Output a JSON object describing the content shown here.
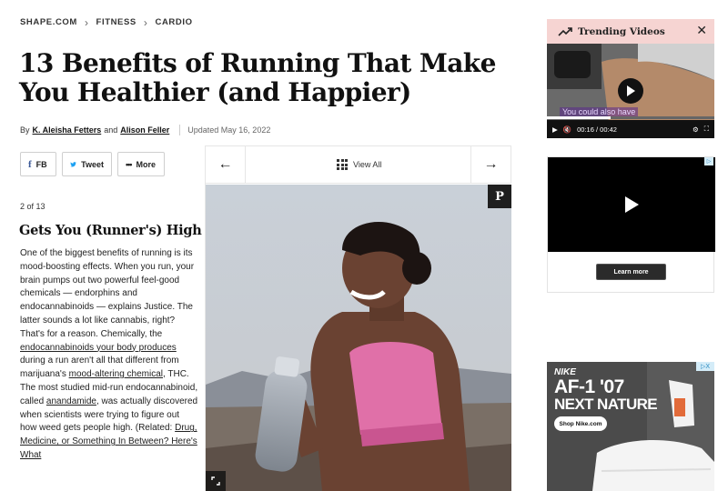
{
  "breadcrumb": {
    "items": [
      "SHAPE.COM",
      "FITNESS",
      "CARDIO"
    ]
  },
  "article": {
    "title": "13 Benefits of Running That Make You Healthier (and Happier)",
    "by_prefix": "By",
    "author1": "K. Aleisha Fetters",
    "and": "and",
    "author2": "Alison Feller",
    "updated": "Updated May 16, 2022"
  },
  "share": {
    "fb_label": "FB",
    "tweet_label": "Tweet",
    "more_label": "More"
  },
  "gallery": {
    "view_all": "View All",
    "counter": "2 of 13",
    "slide_title": "Gets You (Runner's) High",
    "pin_glyph": "P"
  },
  "body": {
    "p1": "One of the biggest benefits of running is its mood-boosting effects. When you run, your brain pumps out two powerful feel-good chemicals — endorphins and endocannabinoids — explains Justice. The latter sounds a lot like cannabis, right? That's for a reason. Chemically, the ",
    "link1": "endocannabinoids your body produces",
    "p2": " during a run aren't all that different from marijuana's ",
    "link2": "mood-altering chemical",
    "p3": ", THC. The most studied mid-run endocannabinoid, called ",
    "link3": "anandamide",
    "p4": ", was actually discovered when scientists were trying to figure out how weed gets people high. (Related: ",
    "link4": "Drug, Medicine, or Something In Between? Here's What"
  },
  "trending": {
    "title": "Trending Videos",
    "caption": "You could also have",
    "time": "00:16 / 00:42",
    "progress": 0.38
  },
  "ads": {
    "learn_more": "Learn more",
    "nike_brand": "NIKE",
    "nike_headline1": "AF-1 '07",
    "nike_headline2": "NEXT NATURE",
    "nike_cta": "Shop Nike.com",
    "adchoice": "▷X"
  },
  "colors": {
    "accent_pink": "#f6d4d2",
    "link_blue": "#3b5998",
    "twitter_blue": "#1da1f2"
  }
}
